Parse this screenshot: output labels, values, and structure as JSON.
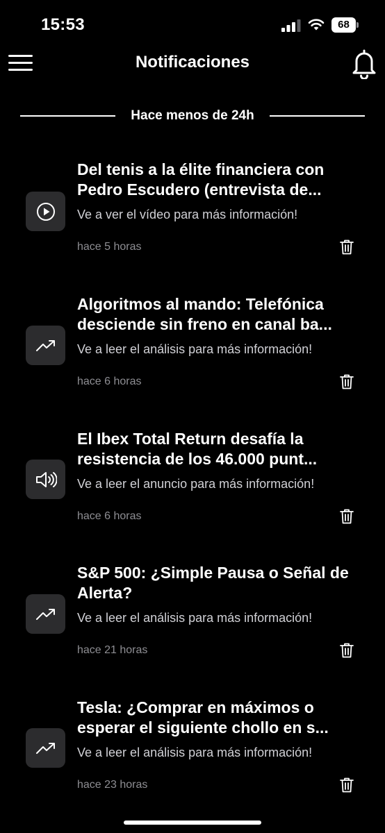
{
  "status_bar": {
    "time": "15:53",
    "battery_level": "68",
    "signal_icon": "cellular-signal-icon",
    "wifi_icon": "wifi-icon"
  },
  "header": {
    "title": "Notificaciones",
    "menu_icon": "hamburger-menu-icon",
    "bell_icon": "bell-icon"
  },
  "section": {
    "label": "Hace menos de 24h"
  },
  "notifications": [
    {
      "icon": "play-circle-icon",
      "title": "Del tenis a la élite financiera con Pedro Escudero (entrevista de...",
      "body": "Ve a ver el vídeo para más información!",
      "time": "hace 5 horas"
    },
    {
      "icon": "trending-up-icon",
      "title": "Algoritmos al mando: Telefónica desciende sin freno en canal ba...",
      "body": "Ve a leer el análisis para más información!",
      "time": "hace 6 horas"
    },
    {
      "icon": "speaker-icon",
      "title": "El Ibex Total Return desafía la resistencia de los 46.000 punt...",
      "body": "Ve a leer el anuncio para más información!",
      "time": "hace 6 horas"
    },
    {
      "icon": "trending-up-icon",
      "title": "S&P 500: ¿Simple Pausa o Señal de Alerta?",
      "body": "Ve a leer el análisis para más información!",
      "time": "hace 21 horas"
    },
    {
      "icon": "trending-up-icon",
      "title": "Tesla: ¿Comprar en máximos o esperar el siguiente chollo en s...",
      "body": "Ve a leer el análisis para más información!",
      "time": "hace 23 horas"
    }
  ],
  "colors": {
    "background": "#000000",
    "text_primary": "#ffffff",
    "text_secondary": "#d1d1d6",
    "text_muted": "#8e8e93",
    "icon_tile": "#2c2c2e"
  }
}
